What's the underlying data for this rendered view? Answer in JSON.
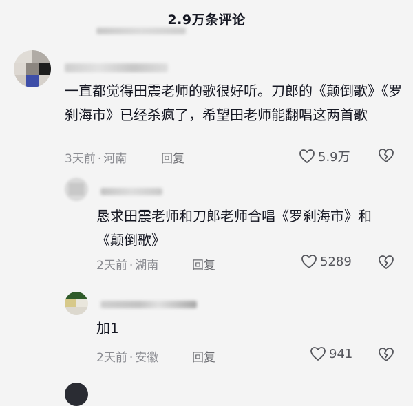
{
  "header": {
    "title": "2.9万条评论"
  },
  "comments": [
    {
      "text": "一直都觉得田震老师的歌很好听。刀郎的《颠倒歌》《罗刹海市》已经杀疯了，希望田老师能翻唱这两首歌",
      "time": "3天前",
      "location": "河南",
      "reply_label": "回复",
      "likes": "5.9万"
    },
    {
      "text": "恳求田震老师和刀郎老师合唱《罗刹海市》和《颠倒歌》",
      "time": "2天前",
      "location": "湖南",
      "reply_label": "回复",
      "likes": "5289"
    },
    {
      "text": "加1",
      "time": "2天前",
      "location": "安徽",
      "reply_label": "回复",
      "likes": "941"
    }
  ],
  "meta_separator": "·",
  "icons": {
    "like": "heart-outline-icon",
    "dislike": "broken-heart-icon"
  },
  "colors": {
    "text": "#161823",
    "meta": "#8a8b91",
    "background": "#f4f4f4"
  }
}
